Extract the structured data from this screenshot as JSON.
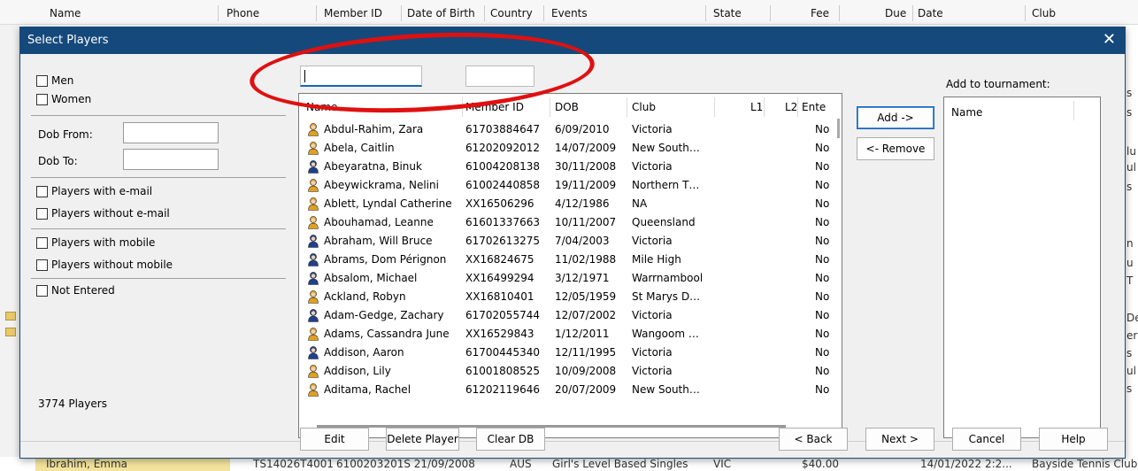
{
  "background": {
    "columns": [
      "Name",
      "Phone",
      "Member ID",
      "Date of Birth",
      "Country",
      "Events",
      "State",
      "Fee",
      "Due",
      "Date",
      "Club"
    ],
    "bottom_row": [
      "Ibrahim, Emma",
      "TS14026T4001",
      "6100203201S 21/09/2008",
      "AUS",
      "Girl's Level Based Singles",
      "VIC",
      "$40.00",
      "14/01/2022 2:2...",
      "Bayside Tennis Club"
    ],
    "right_fragments": [
      "s",
      "s",
      "lu",
      "ul",
      "s",
      "n",
      "u",
      "T",
      "De",
      "er",
      "s",
      "ul",
      "s"
    ]
  },
  "dialog": {
    "title": "Select Players",
    "close_label": "✕",
    "filters": {
      "men": "Men",
      "women": "Women",
      "dob_from_label": "Dob From:",
      "dob_to_label": "Dob To:",
      "dob_from_value": "",
      "dob_to_value": "",
      "with_email": "Players with e-mail",
      "without_email": "Players without e-mail",
      "with_mobile": "Players with mobile",
      "without_mobile": "Players without mobile",
      "not_entered": "Not Entered"
    },
    "player_count": "3774 Players",
    "search_name_value": "",
    "search_id_value": "",
    "list": {
      "headers": [
        "Name",
        "Member ID",
        "DOB",
        "Club",
        "L1",
        "L2",
        "Ente"
      ],
      "rows": [
        {
          "name": "Abdul-Rahim, Zara",
          "id": "61703884647",
          "dob": "6/09/2010",
          "club": "Victoria",
          "l1": "",
          "l2": "",
          "entered": "No",
          "gender": "f"
        },
        {
          "name": "Abela, Caitlin",
          "id": "61202092012",
          "dob": "14/07/2009",
          "club": "New South…",
          "l1": "",
          "l2": "",
          "entered": "No",
          "gender": "f"
        },
        {
          "name": "Abeyaratna, Binuk",
          "id": "61004208138",
          "dob": "30/11/2008",
          "club": "Victoria",
          "l1": "",
          "l2": "",
          "entered": "No",
          "gender": "m"
        },
        {
          "name": "Abeywickrama, Nelini",
          "id": "61002440858",
          "dob": "19/11/2009",
          "club": "Northern T…",
          "l1": "",
          "l2": "",
          "entered": "No",
          "gender": "f"
        },
        {
          "name": "Ablett, Lyndal Catherine",
          "id": "XX16506296",
          "dob": "4/12/1986",
          "club": "NA",
          "l1": "",
          "l2": "",
          "entered": "No",
          "gender": "f"
        },
        {
          "name": "Abouhamad, Leanne",
          "id": "61601337663",
          "dob": "10/11/2007",
          "club": "Queensland",
          "l1": "",
          "l2": "",
          "entered": "No",
          "gender": "f"
        },
        {
          "name": "Abraham, Will Bruce",
          "id": "61702613275",
          "dob": "7/04/2003",
          "club": "Victoria",
          "l1": "",
          "l2": "",
          "entered": "No",
          "gender": "m"
        },
        {
          "name": "Abrams, Dom Pérignon",
          "id": "XX16824675",
          "dob": "11/02/1988",
          "club": "Mile High",
          "l1": "",
          "l2": "",
          "entered": "No",
          "gender": "m"
        },
        {
          "name": "Absalom, Michael",
          "id": "XX16499294",
          "dob": "3/12/1971",
          "club": "Warrnambool",
          "l1": "",
          "l2": "",
          "entered": "No",
          "gender": "m"
        },
        {
          "name": "Ackland, Robyn",
          "id": "XX16810401",
          "dob": "12/05/1959",
          "club": "St Marys D…",
          "l1": "",
          "l2": "",
          "entered": "No",
          "gender": "f"
        },
        {
          "name": "Adam-Gedge, Zachary",
          "id": "61702055744",
          "dob": "12/07/2002",
          "club": "Victoria",
          "l1": "",
          "l2": "",
          "entered": "No",
          "gender": "m"
        },
        {
          "name": "Adams, Cassandra June",
          "id": "XX16529843",
          "dob": "1/12/2011",
          "club": "Wangoom …",
          "l1": "",
          "l2": "",
          "entered": "No",
          "gender": "f"
        },
        {
          "name": "Addison, Aaron",
          "id": "61700445340",
          "dob": "12/11/1995",
          "club": "Victoria",
          "l1": "",
          "l2": "",
          "entered": "No",
          "gender": "m"
        },
        {
          "name": "Addison, Lily",
          "id": "61001808525",
          "dob": "10/09/2008",
          "club": "Victoria",
          "l1": "",
          "l2": "",
          "entered": "No",
          "gender": "f"
        },
        {
          "name": "Aditama, Rachel",
          "id": "61202119646",
          "dob": "20/07/2009",
          "club": "New South…",
          "l1": "",
          "l2": "",
          "entered": "No",
          "gender": "f"
        }
      ]
    },
    "add_button": "Add ->",
    "remove_button": "<- Remove",
    "add_to_label": "Add to tournament:",
    "add_header": "Name",
    "buttons": {
      "edit": "Edit",
      "delete": "Delete Player",
      "clear": "Clear DB",
      "back": "< Back",
      "next": "Next >",
      "cancel": "Cancel",
      "help": "Help"
    }
  },
  "colors": {
    "titlebar": "#15497b",
    "annotation": "#e01010",
    "female_icon": "#e0a020",
    "male_icon": "#1f3f8f"
  }
}
